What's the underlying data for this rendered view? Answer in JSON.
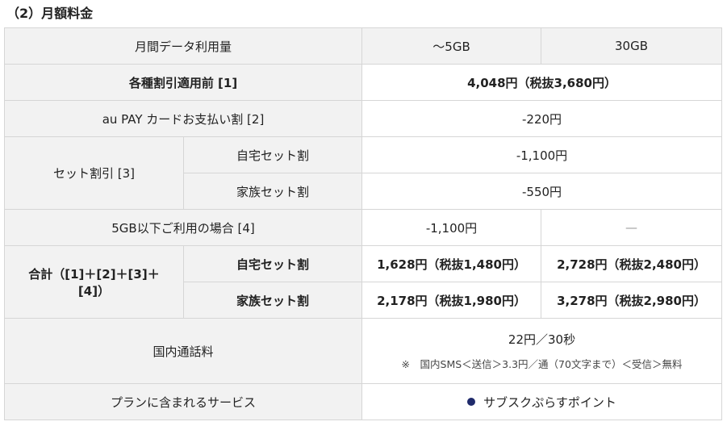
{
  "section_title": "（2）月額料金",
  "header": {
    "label": "月間データ利用量",
    "col1": "〜5GB",
    "col2": "30GB"
  },
  "rows": {
    "before_discount": {
      "label": "各種割引適用前 [1]",
      "value": "4,048円（税抜3,680円）"
    },
    "au_pay": {
      "label": "au PAY カードお支払い割 [2]",
      "value": "-220円"
    },
    "set_discount": {
      "label": "セット割引 [3]",
      "home": {
        "label": "自宅セット割",
        "value": "-1,100円"
      },
      "family": {
        "label": "家族セット割",
        "value": "-550円"
      }
    },
    "under5gb": {
      "label": "5GB以下ご利用の場合 [4]",
      "col1": "-1,100円",
      "col2": "—"
    },
    "total": {
      "label_line1": "合計（[1]＋[2]＋[3]＋",
      "label_line2": "[4]）",
      "home": {
        "label": "自宅セット割",
        "col1": "1,628円（税抜1,480円）",
        "col2": "2,728円（税抜2,480円）"
      },
      "family": {
        "label": "家族セット割",
        "col1": "2,178円（税抜1,980円）",
        "col2": "3,278円（税抜2,980円）"
      }
    },
    "call": {
      "label": "国内通話料",
      "value": "22円／30秒",
      "note": "※　国内SMS＜送信＞3.3円／通（70文字まで）＜受信＞無料"
    },
    "service": {
      "label": "プランに含まれるサービス",
      "value": "サブスクぷらすポイント"
    }
  },
  "colors": {
    "header_bg": "#f2f2f2",
    "border": "#d6d6d6",
    "bullet": "#1f2a6b"
  }
}
